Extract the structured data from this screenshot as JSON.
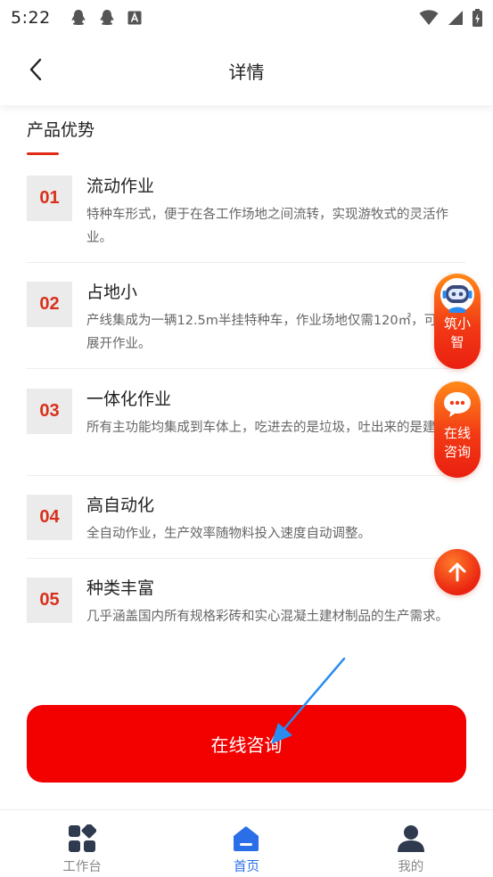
{
  "status_bar": {
    "time": "5:22"
  },
  "nav": {
    "title": "详情"
  },
  "section": {
    "title": "产品优势"
  },
  "features": [
    {
      "num": "01",
      "title": "流动作业",
      "desc": "特种车形式，便于在各工作场地之间流转，实现游牧式的灵活作业。"
    },
    {
      "num": "02",
      "title": "占地小",
      "desc": "产线集成为一辆12.5m半挂特种车，作业场地仅需120㎡，可随地展开作业。"
    },
    {
      "num": "03",
      "title": "一体化作业",
      "desc": "所有主功能均集成到车体上，吃进去的是垃圾，吐出来的是建材。"
    },
    {
      "num": "04",
      "title": "高自动化",
      "desc": "全自动作业，生产效率随物料投入速度自动调整。"
    },
    {
      "num": "05",
      "title": "种类丰富",
      "desc": "几乎涵盖国内所有规格彩砖和实心混凝土建材制品的生产需求。"
    }
  ],
  "floating": {
    "assistant_label": "筑小智",
    "consult_label": "在线咨询"
  },
  "consult_button": {
    "label": "在线咨询"
  },
  "tabs": [
    {
      "label": "工作台"
    },
    {
      "label": "首页"
    },
    {
      "label": "我的"
    }
  ],
  "colors": {
    "accent_red": "#f30000",
    "tab_active": "#2a6fe8",
    "number_red": "#d9301c"
  }
}
